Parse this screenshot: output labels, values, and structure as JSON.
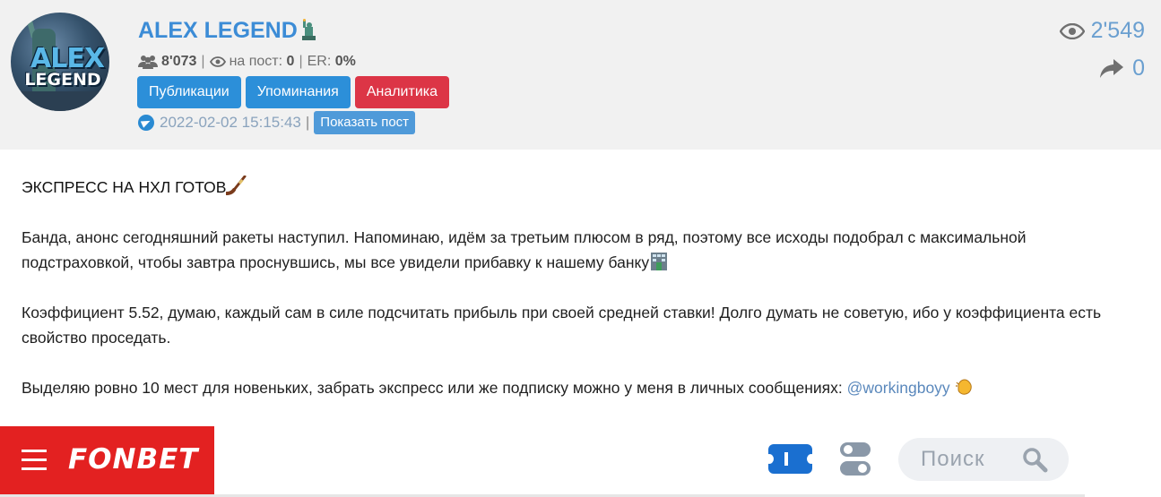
{
  "channel": {
    "name": "ALEX LEGEND",
    "avatar": {
      "line1": "ALEX",
      "line2": "LEGEND"
    },
    "stats": {
      "subscribers": "8'073",
      "per_post_label": "на пост:",
      "per_post": "0",
      "er_label": "ER:",
      "er": "0%"
    },
    "tabs": [
      {
        "label": "Публикации",
        "color": "#2c8fd9"
      },
      {
        "label": "Упоминания",
        "color": "#2c8fd9"
      },
      {
        "label": "Аналитика",
        "color": "#dc3546"
      }
    ],
    "date": "2022-02-02 15:15:43",
    "show_post_label": "Показать пост",
    "views": "2'549",
    "shares": "0"
  },
  "post": {
    "title": "ЭКСПРЕСС НА НХЛ ГОТОВ",
    "para1": "Банда, анонс сегодняшний ракеты наступил. Напоминаю, идём за третьим плюсом в ряд, поэтому все исходы подобрал с максимальной подстраховкой, чтобы завтра проснувшись, мы все увидели прибавку к нашему банку",
    "para2": "Коэффициент 5.52, думаю, каждый сам в силе подсчитать прибыль при своей средней ставки! Долго думать не советую, ибо у коэффициента есть свойство проседать.",
    "para3": "Выделяю ровно 10 мест для новеньких, забрать экспресс или же подписку можно у меня в личных сообщениях:",
    "mention": "@workingboyy"
  },
  "banner": {
    "brand": "FONBET",
    "brand_color": "#e32121",
    "search_placeholder": "Поиск"
  },
  "colors": {
    "accent": "#3c8cd6",
    "header_bg": "#f1f1f1"
  }
}
